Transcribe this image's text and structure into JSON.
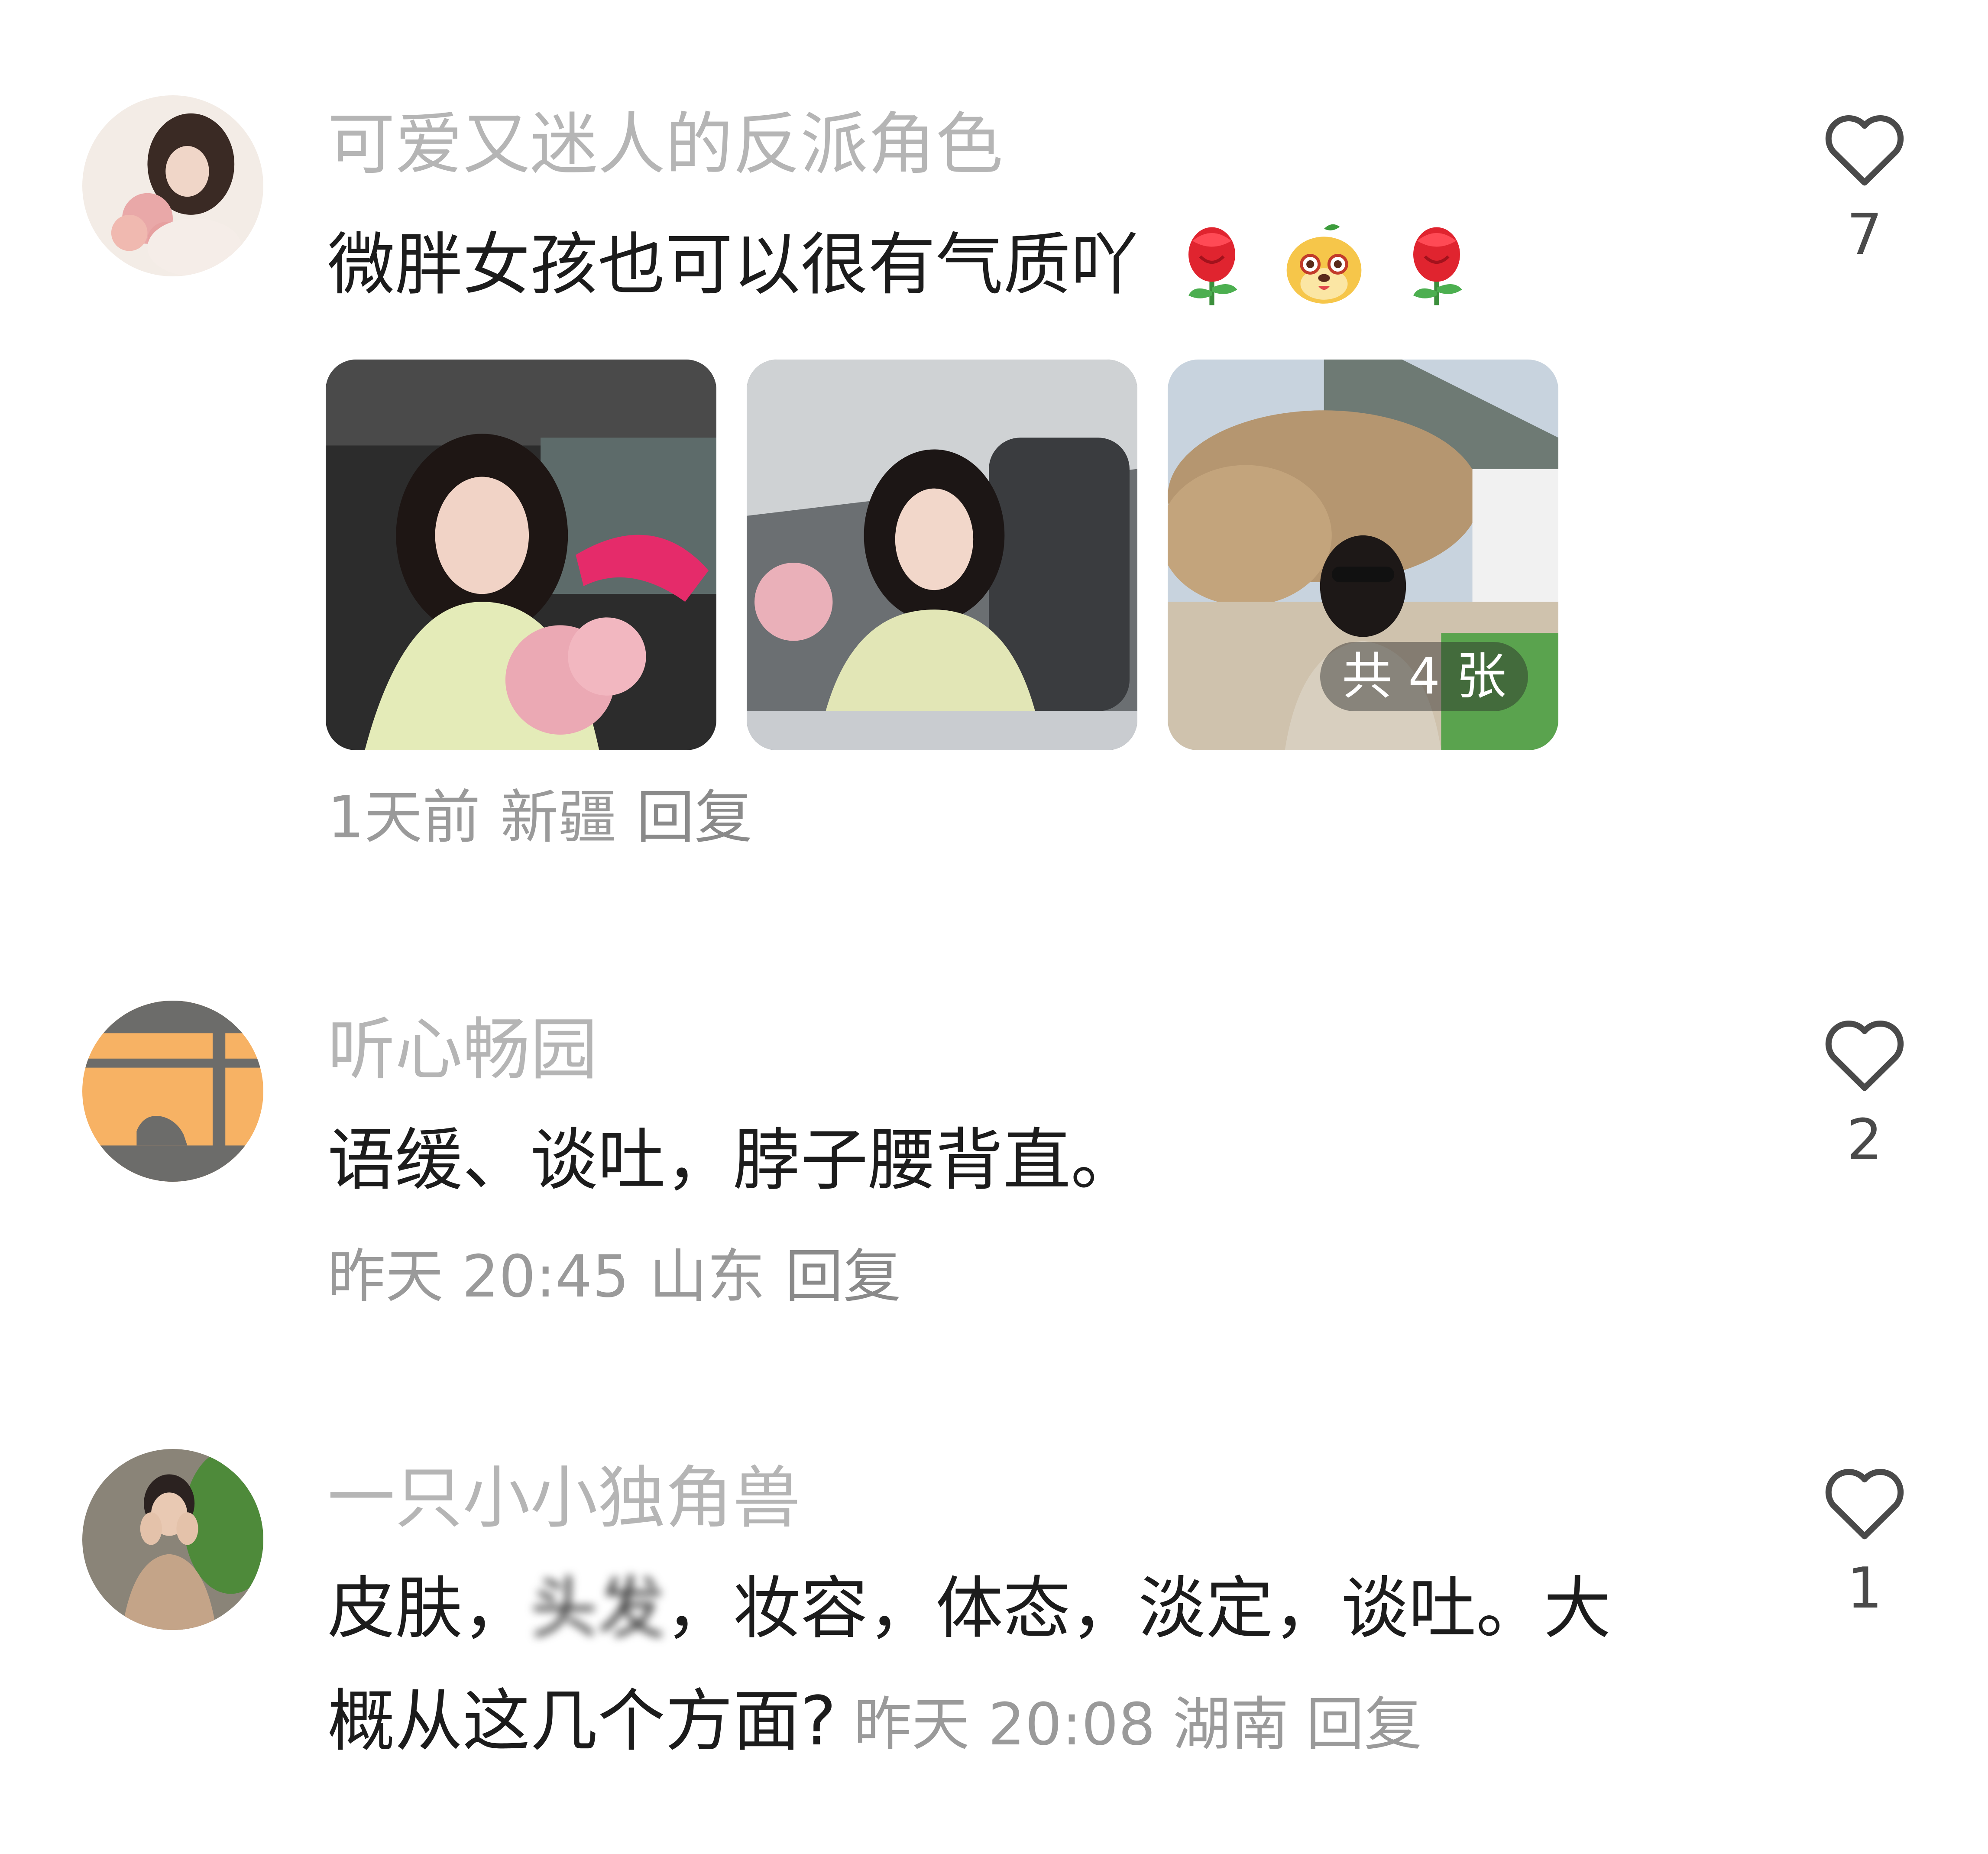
{
  "comments": [
    {
      "username": "可爱又迷人的反派角色",
      "text": "微胖女孩也可以很有气质吖",
      "emojis": [
        "rose-emoji",
        "dog-face-emoji",
        "rose-emoji"
      ],
      "photos": [
        "photo-1",
        "photo-2",
        "photo-3"
      ],
      "photo_count_label": "共 4 张",
      "time": "1天前",
      "location": "新疆",
      "reply_label": "回复",
      "likes": "7"
    },
    {
      "username": "听心畅园",
      "text": "语缓、谈吐，脖子腰背直。",
      "time": "昨天 20:45",
      "location": "山东",
      "reply_label": "回复",
      "likes": "2"
    },
    {
      "username": "一只小小独角兽",
      "text_line1_a": "皮肤，",
      "text_line1_blurred": "头发",
      "text_line1_b": "，妆容，体态，淡定，谈吐。大",
      "text_line2": "概从这几个方面?",
      "time": "昨天 20:08",
      "location": "湖南",
      "reply_label": "回复",
      "likes": "1"
    }
  ],
  "icons": {
    "like": "heart-outline-icon"
  },
  "colors": {
    "username": "#b5b5b5",
    "text": "#1c1c1c",
    "meta": "#9a9a9a",
    "heart": "#4a4a4a"
  }
}
